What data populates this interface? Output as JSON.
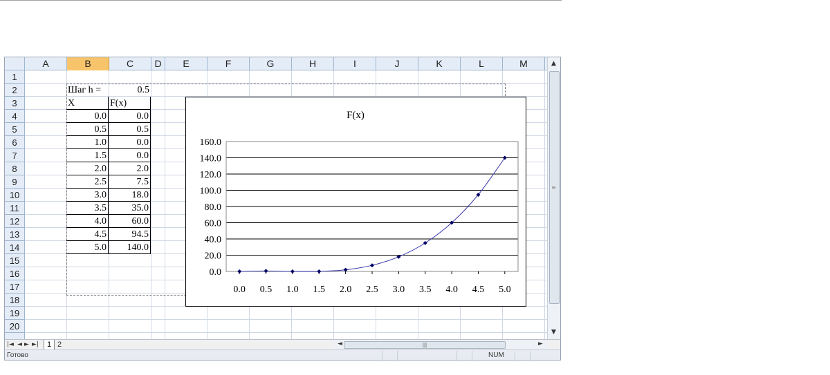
{
  "columns": [
    "A",
    "B",
    "C",
    "D",
    "E",
    "F",
    "G",
    "H",
    "I",
    "J",
    "K",
    "L",
    "M"
  ],
  "selected_column": "B",
  "rows": [
    "1",
    "2",
    "3",
    "4",
    "5",
    "6",
    "7",
    "8",
    "9",
    "10",
    "11",
    "12",
    "13",
    "14",
    "15",
    "16",
    "17",
    "18",
    "19",
    "20"
  ],
  "table": {
    "step_label": "Шаг h =",
    "step_value": "0.5",
    "x_header": "X",
    "f_header": "F(x)",
    "x_values": [
      "0.0",
      "0.5",
      "1.0",
      "1.5",
      "2.0",
      "2.5",
      "3.0",
      "3.5",
      "4.0",
      "4.5",
      "5.0"
    ],
    "f_values": [
      "0.0",
      "0.5",
      "0.0",
      "0.0",
      "2.0",
      "7.5",
      "18.0",
      "35.0",
      "60.0",
      "94.5",
      "140.0"
    ]
  },
  "chart_data": {
    "type": "line",
    "title": "F(x)",
    "categories": [
      "0.0",
      "0.5",
      "1.0",
      "1.5",
      "2.0",
      "2.5",
      "3.0",
      "3.5",
      "4.0",
      "4.5",
      "5.0"
    ],
    "series": [
      {
        "values": [
          0.0,
          0.5,
          0.0,
          0.0,
          2.0,
          7.5,
          18.0,
          35.0,
          60.0,
          94.5,
          140.0
        ]
      }
    ],
    "yticks": [
      "0.0",
      "20.0",
      "40.0",
      "60.0",
      "80.0",
      "100.0",
      "120.0",
      "140.0",
      "160.0"
    ],
    "ylim": [
      0,
      160
    ],
    "grid": true,
    "line_color": "#3333aa",
    "marker_color": "#000066"
  },
  "sheet_tabs": [
    "1",
    "2"
  ],
  "active_tab": "1",
  "status": {
    "ready": "Готово",
    "num": "NUM"
  }
}
